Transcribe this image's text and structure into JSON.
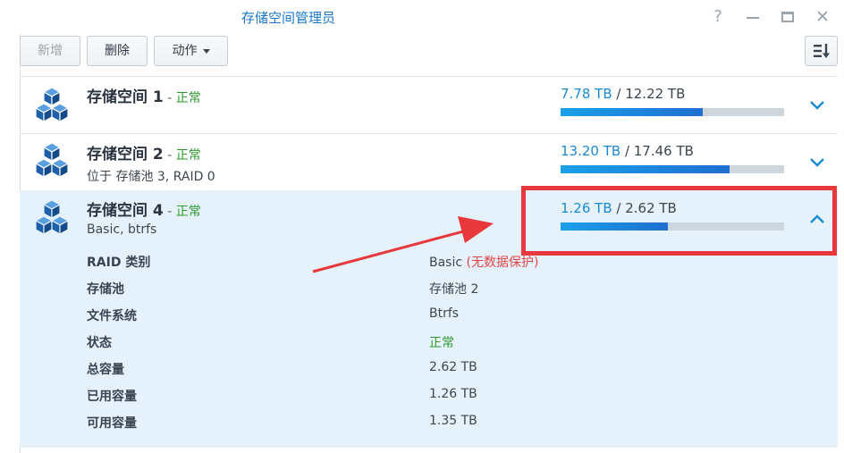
{
  "window": {
    "title": "存储空间管理员",
    "help_glyph": "?",
    "close_glyph": "✕"
  },
  "toolbar": {
    "new_label": "新增",
    "delete_label": "删除",
    "action_label": "动作"
  },
  "volumes": [
    {
      "name": "存储空间 1",
      "dash": " - ",
      "status": "正常",
      "subtitle": "",
      "used": "7.78 TB",
      "separator": " / ",
      "total": "12.22 TB",
      "usage_fraction": 0.637,
      "expanded": false
    },
    {
      "name": "存储空间 2",
      "dash": " - ",
      "status": "正常",
      "subtitle": "位于 存储池 3, RAID 0",
      "used": "13.20 TB",
      "separator": " / ",
      "total": "17.46 TB",
      "usage_fraction": 0.756,
      "expanded": false
    },
    {
      "name": "存储空间 4",
      "dash": " - ",
      "status": "正常",
      "subtitle": "Basic, btrfs",
      "used": "1.26 TB",
      "separator": " / ",
      "total": "2.62 TB",
      "usage_fraction": 0.481,
      "expanded": true
    }
  ],
  "details": {
    "raid_type_label": "RAID 类别",
    "raid_type_value": "Basic",
    "raid_type_note": "(无数据保护)",
    "pool_label": "存储池",
    "pool_value": "存储池 2",
    "fs_label": "文件系统",
    "fs_value": "Btrfs",
    "status_label": "状态",
    "status_value": "正常",
    "total_label": "总容量",
    "total_value": "2.62 TB",
    "used_label": "已用容量",
    "used_value": "1.26 TB",
    "free_label": "可用容量",
    "free_value": "1.35 TB"
  },
  "colors": {
    "accent": "#1a8ad4",
    "status_ok": "#2c9a2c",
    "warning": "#e04545",
    "annotation": "#e8383b",
    "expanded_row_bg": "#e6f2fb"
  },
  "icons": {
    "volume": "stacked-cubes-icon",
    "sort": "sort-icon",
    "expand": "chevron-down-icon",
    "collapse": "chevron-up-icon"
  }
}
